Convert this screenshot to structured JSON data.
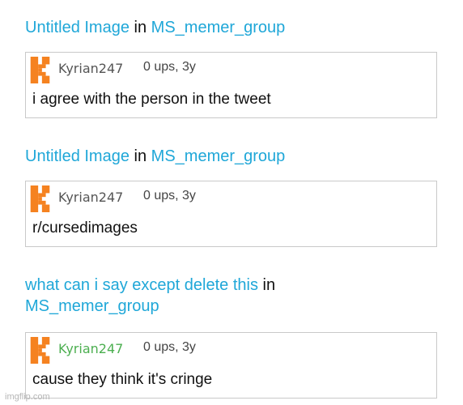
{
  "entries": [
    {
      "image_title": "Untitled Image",
      "in_word": "in",
      "stream": "MS_memer_group",
      "username": "Kyrian247",
      "meta": "0 ups, 3y",
      "comment": "i agree with the person in the tweet"
    },
    {
      "image_title": "Untitled Image",
      "in_word": "in",
      "stream": "MS_memer_group",
      "username": "Kyrian247",
      "meta": "0 ups, 3y",
      "comment": "r/cursedimages"
    },
    {
      "image_title": "what can i say except delete this",
      "in_word": "in",
      "stream": "MS_memer_group",
      "username": "Kyrian247",
      "meta": "0 ups, 3y",
      "comment": "cause they think it's cringe"
    }
  ],
  "watermark": "imgflip.com",
  "colors": {
    "link": "#1fa7d8",
    "avatar_orange": "#f58220",
    "username_green": "#4caf50",
    "card_border": "#c9c9c9"
  },
  "icons": {
    "avatar": "pixel-k-avatar-icon"
  }
}
